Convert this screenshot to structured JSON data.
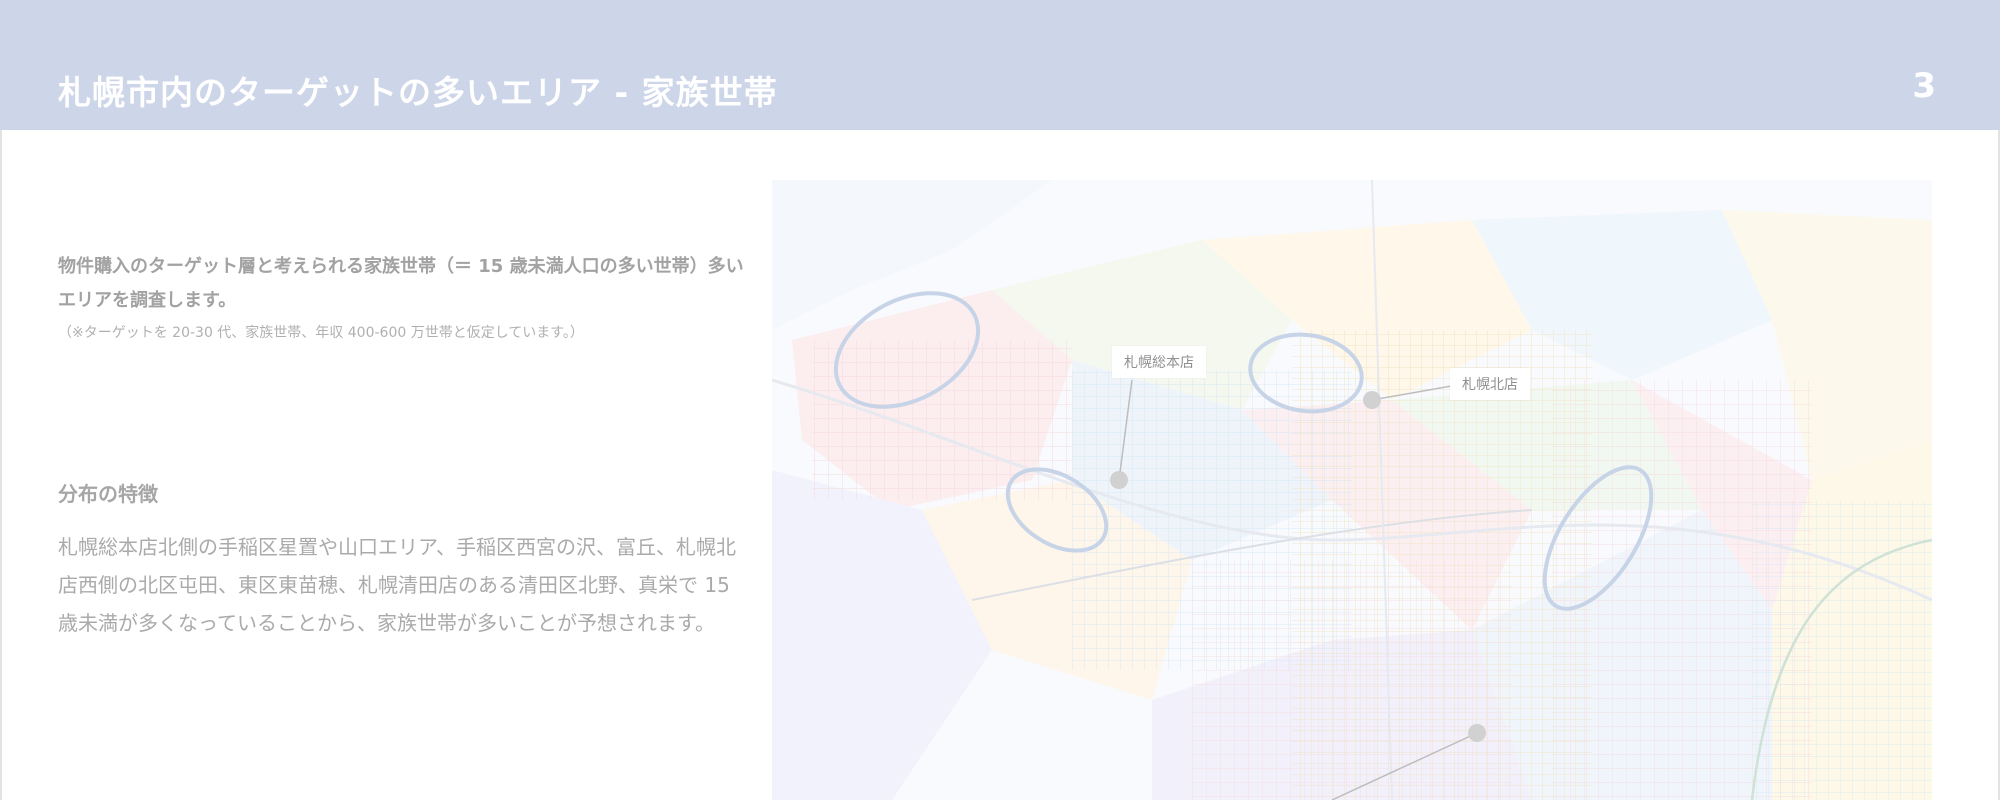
{
  "header": {
    "title": "札幌市内のターゲットの多いエリア - 家族世帯",
    "page_number": "3"
  },
  "intro": {
    "text": "物件購入のターゲット層と考えられる家族世帯（＝ 15 歳未満人口の多い世帯）多いエリアを調査します。",
    "note": "（※ターゲットを 20-30 代、家族世帯、年収 400-600 万世帯と仮定しています。）"
  },
  "distribution": {
    "heading": "分布の特徴",
    "body": "札幌総本店北側の手稲区星置や山口エリア、手稲区西宮の沢、富丘、札幌北店西側の北区屯田、東区東苗穂、札幌清田店のある清田区北野、真栄で 15 歳未満が多くなっていることから、家族世帯が多いことが予想されます。"
  },
  "map": {
    "labels": {
      "store_main": "札幌総本店",
      "store_north": "札幌北店"
    },
    "colors": {
      "highlight_ellipse": "#a9bddb",
      "store_marker": "#b8b8b8"
    }
  }
}
